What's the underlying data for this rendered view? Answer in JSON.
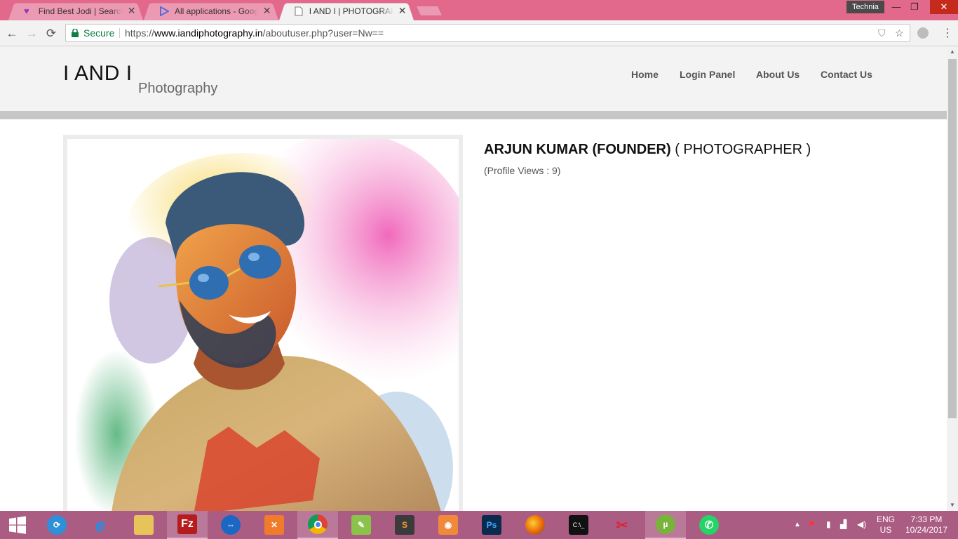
{
  "browser": {
    "tabs": [
      {
        "title": "Find Best Jodi | Search F",
        "active": false
      },
      {
        "title": "All applications - Google",
        "active": false
      },
      {
        "title": "I AND I | PHOTOGRAPHY",
        "active": true
      }
    ],
    "profile_name": "Technia",
    "security_label": "Secure",
    "url_scheme": "https://",
    "url_host": "www.iandiphotography.in",
    "url_path": "/aboutuser.php?user=Nw=="
  },
  "site": {
    "logo_main": "I AND I",
    "logo_sub": "Photography",
    "nav": [
      "Home",
      "Login Panel",
      "About Us",
      "Contact Us"
    ]
  },
  "profile": {
    "name": "ARJUN KUMAR (FOUNDER)",
    "role": " ( PHOTOGRAPHER )",
    "views": "(Profile Views : 9)"
  },
  "taskbar": {
    "apps": [
      "teamviewer-like",
      "internet-explorer",
      "file-explorer",
      "filezilla",
      "teamviewer",
      "xampp",
      "chrome",
      "notepad-plus",
      "sublime-text",
      "vlc-like",
      "photoshop",
      "firefox",
      "command-prompt",
      "snipping-tool",
      "utorrent",
      "whatsapp"
    ],
    "lang": "ENG",
    "region": "US",
    "time": "7:33 PM",
    "date": "10/24/2017"
  },
  "colors": {
    "chrome_frame": "#e2688c",
    "taskbar": "#ab5c83",
    "secure_green": "#0b8043"
  }
}
